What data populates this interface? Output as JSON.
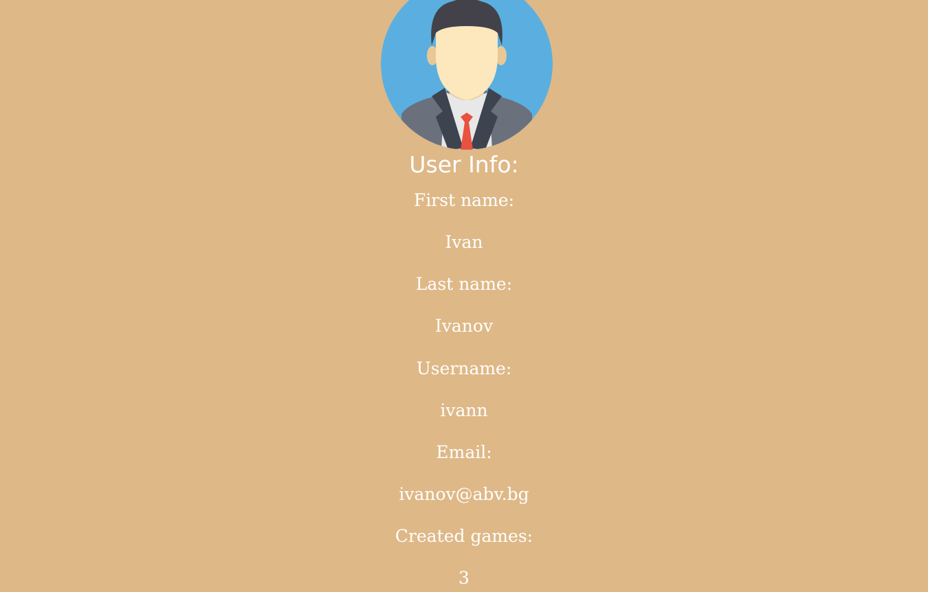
{
  "profile": {
    "avatar_icon": "businessman-avatar-icon",
    "title": "User Info:",
    "first_name_label": "First name:",
    "first_name": "Ivan",
    "last_name_label": "Last name:",
    "last_name": "Ivanov",
    "username_label": "Username:",
    "username": "ivann",
    "email_label": "Email:",
    "email": "ivanov@abv.bg",
    "created_games_label": "Created games:",
    "created_games": "3"
  },
  "colors": {
    "background": "#deb887",
    "text": "#ffffff",
    "avatar_background": "#5aafe0"
  }
}
